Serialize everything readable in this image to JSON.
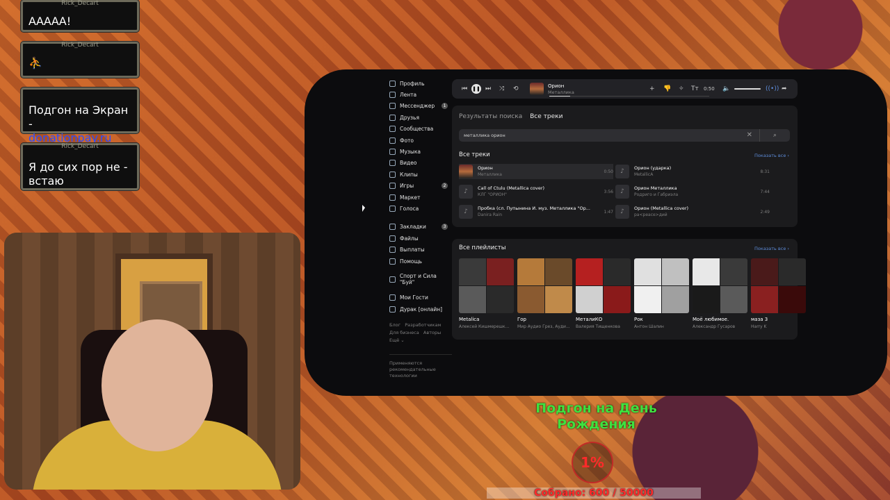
{
  "chat": [
    {
      "nick": "Rick_Decart",
      "text": "АААAА!"
    },
    {
      "nick": "Rick_Decart",
      "text": ""
    },
    {
      "nick": "",
      "text": "Подгон на Экран -",
      "link": "donationpay.ru"
    },
    {
      "nick": "Rick_Decart",
      "text": "Я до сих пор не - встаю"
    }
  ],
  "sidebar": {
    "items": [
      {
        "label": "Профиль",
        "badge": ""
      },
      {
        "label": "Лента",
        "badge": ""
      },
      {
        "label": "Мессенджер",
        "badge": "1"
      },
      {
        "label": "Друзья",
        "badge": ""
      },
      {
        "label": "Сообщества",
        "badge": ""
      },
      {
        "label": "Фото",
        "badge": ""
      },
      {
        "label": "Музыка",
        "badge": ""
      },
      {
        "label": "Видео",
        "badge": ""
      },
      {
        "label": "Клипы",
        "badge": ""
      },
      {
        "label": "Игры",
        "badge": "2"
      },
      {
        "label": "Маркет",
        "badge": ""
      },
      {
        "label": "Голоса",
        "badge": ""
      }
    ],
    "items2": [
      {
        "label": "Закладки",
        "badge": "3"
      },
      {
        "label": "Файлы",
        "badge": ""
      },
      {
        "label": "Выплаты",
        "badge": ""
      },
      {
        "label": "Помощь",
        "badge": ""
      }
    ],
    "community": "Спорт и Сила \"Буй\"",
    "apps": [
      {
        "label": "Мои Гости"
      },
      {
        "label": "Дурак [онлайн]"
      }
    ],
    "footer": {
      "blog": "Блог",
      "dev": "Разработчикам",
      "biz": "Для бизнеса",
      "ads": "Авторы",
      "more": "Ещё ⌄",
      "rec": "Применяются рекомендательные технологии"
    }
  },
  "player": {
    "title": "Орион",
    "artist": "Металлика",
    "time": "0:50"
  },
  "main": {
    "crumb1": "Результаты поиска",
    "crumb2": "Все треки",
    "query": "металлика орион",
    "tracks_header": "Все треки",
    "show_all": "Показать все ›",
    "tracks": [
      {
        "title": "Орион",
        "artist": "Металлика",
        "dur": "0:50"
      },
      {
        "title": "Call of Ctulu (Metallica cover)",
        "artist": "КЛГ \"ОРИОН\"",
        "dur": "3:56"
      },
      {
        "title": "Пробка (сл. Пупынина И. муз. Металлика \"Ор...",
        "artist": "Danira Rain",
        "dur": "1:47"
      },
      {
        "title": "Орион (ударка)",
        "artist": "MetallicA",
        "dur": "8:31"
      },
      {
        "title": "Орион Металлика",
        "artist": "Родриго и Габриэла",
        "dur": "7:44"
      },
      {
        "title": "Орион (Metallica cover)",
        "artist": "ра<реасе>дий",
        "dur": "2:49"
      }
    ],
    "playlists_header": "Все плейлисты",
    "playlists_all": "Показать все ›",
    "playlists": [
      {
        "name": "Metalica",
        "author": "Алексей Кишмерешк..."
      },
      {
        "name": "Гор",
        "author": "Мир Аудио Грез, Ауди..."
      },
      {
        "name": "МеталиКО",
        "author": "Валерия Тищенкова"
      },
      {
        "name": "Рок",
        "author": "Антон Шалин"
      },
      {
        "name": "Моё любимое.",
        "author": "Александр Гусаров"
      },
      {
        "name": "маза 3",
        "author": "Harry K"
      }
    ]
  },
  "overlay": {
    "title1": "Подгон на День",
    "title2": "Рождения",
    "percent": "1%",
    "collected": "Собрано: 600 / 50000"
  },
  "colors": {
    "green": "#3fe03f",
    "red": "#ff2a2a",
    "link": "#5d8bd8"
  }
}
